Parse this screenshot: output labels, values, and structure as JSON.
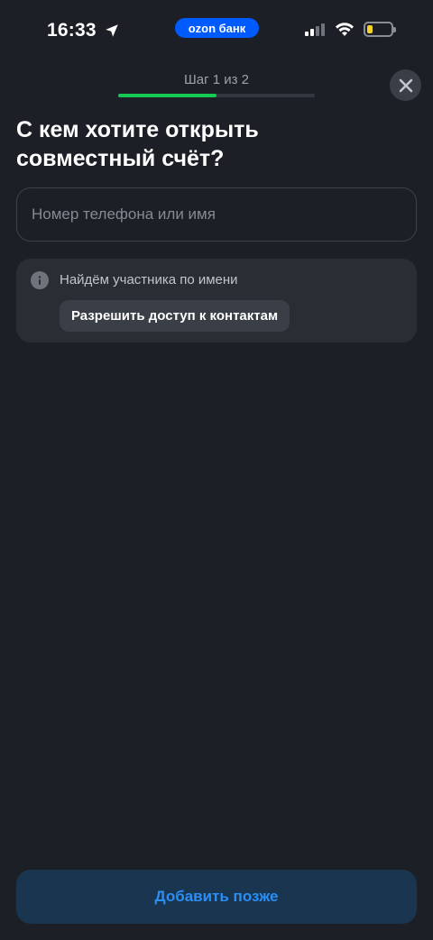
{
  "status_bar": {
    "time": "16:33",
    "bank_badge": "ozon банк",
    "icons": [
      "location-arrow-icon",
      "cellular-signal-icon",
      "wifi-icon",
      "battery-icon"
    ],
    "battery_color": "#f5d22b"
  },
  "header": {
    "step_label": "Шаг 1 из 2",
    "progress": 0.5,
    "progress_color": "#16c954"
  },
  "main": {
    "title": "С кем хотите открыть совместный счёт?",
    "search": {
      "placeholder": "Номер телефона или имя",
      "value": ""
    },
    "info_card": {
      "text": "Найдём участника по имени",
      "button_label": "Разрешить доступ к контактам"
    }
  },
  "footer": {
    "later_button_label": "Добавить позже"
  },
  "colors": {
    "background": "#1c1f26",
    "accent": "#2a8ef5",
    "brand": "#005bff"
  }
}
